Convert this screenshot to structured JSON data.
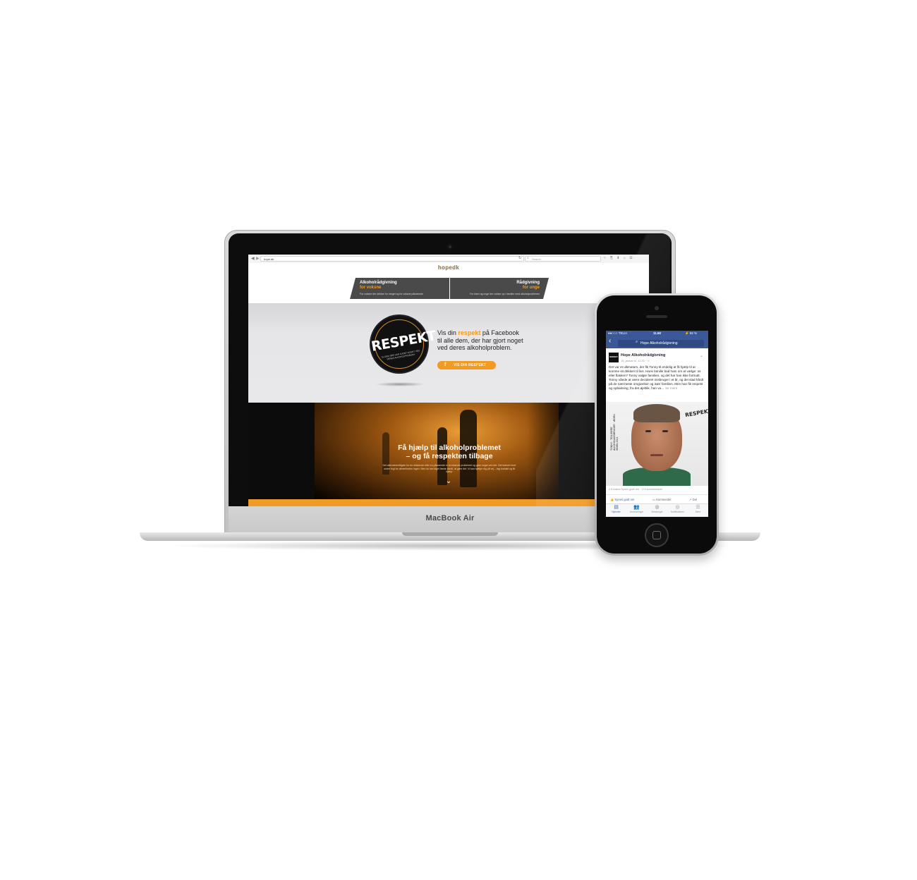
{
  "laptop": {
    "model_label": "MacBook Air",
    "browser": {
      "url": "hope.dk",
      "search_placeholder": "Search",
      "icons": [
        "back-icon",
        "forward-icon",
        "reload-icon",
        "search-icon",
        "star-icon",
        "share-icon"
      ]
    },
    "site": {
      "logo": "hopedk",
      "tabs": [
        {
          "title": "Alkoholrådgivning",
          "subtitle": "for voksne",
          "description": "For voksne der drikker for meget og for voksne pårørende"
        },
        {
          "title": "Rådgivning",
          "subtitle": "for unge",
          "description": "For børn og unge der vokser op i familier med alkoholproblemer"
        }
      ],
      "badge": {
        "word": "RESPEKT",
        "subtext": "TIL DEM DER HAR GJORT NOGET VED DERES ALKOHOLPROBLEM"
      },
      "hero": {
        "line_prefix": "Vis din ",
        "highlight": "respekt",
        "line_suffix": " på Facebook",
        "line2": "til alle dem, der har gjort noget",
        "line3": "ved deres alkoholproblem.",
        "cta": "VIS DIN RESPEKT"
      },
      "section2": {
        "title_line1": "Få hjælp til alkoholproblemet",
        "title_line2": "– og få respekten tilbage",
        "body": "Det allervæsentligste for en drikkende eller en pårørende er at erkende problemet og gøre noget ved det. Det kræver'mod' under fugl for almenheden ingen. Men du har taget første skridt, at gøre det. Vi kan hjælpe dig på vej – tag kontakt og få hjælp."
      },
      "accent": "#f19a24"
    }
  },
  "phone": {
    "status": {
      "carrier": "●●○○○ TELIA",
      "time": "11.50",
      "battery": "⚡ 82 %"
    },
    "search_text": "Hope Alkoholrådgivning",
    "post": {
      "author": "Hope Alkoholrådgivning",
      "avatar_text": "RESPEKT",
      "date": "10. januar kl. 11.33 · ☉",
      "text": "Det var et ultimatum, der fik Tonny til endelig at få hjælp til at komme sit drikkeri til livs. Hans familie bad ham om at vælge: os eller flasken? Tonny valgte familien, og det har han ikke fortrudt. Tonny nåede at være decideret misbruger i et år, og det slad hårdt på de nærmeste omgivelser og især familien. Men han fik respekt og opbakning, fra det øjeblik, han va…",
      "see_more": "Se mere",
      "photo_caption": "TONNY · TIDLIGERE ALKOHOLMISBRUGER · ÆDRU SIDEN 2014",
      "photo_badge": "RESPEKT",
      "stats": "2,5 tusind Synes godt om · 174 kommentarer",
      "actions": {
        "like": "Synes godt om",
        "comment": "Kommentér",
        "share": "Del"
      }
    },
    "tabs": [
      {
        "icon": "news-feed-icon",
        "label": "Nyheder"
      },
      {
        "icon": "friends-icon",
        "label": "Anmodninger"
      },
      {
        "icon": "messenger-icon",
        "label": "Messenger"
      },
      {
        "icon": "globe-icon",
        "label": "Notifikationer"
      },
      {
        "icon": "menu-icon",
        "label": "Mere"
      }
    ],
    "brand_color": "#3b5998"
  }
}
